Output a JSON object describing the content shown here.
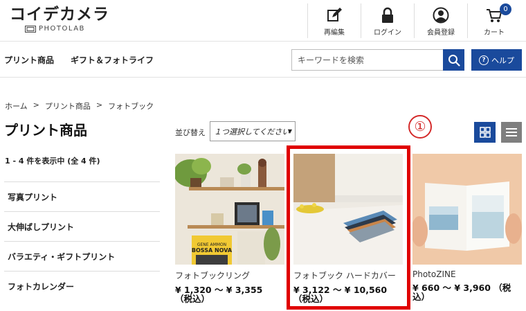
{
  "header": {
    "logo_main": "コイデカメラ",
    "logo_sub": "PHOTOLAB",
    "nav": [
      {
        "label": "再編集",
        "icon": "edit-icon"
      },
      {
        "label": "ログイン",
        "icon": "lock-icon"
      },
      {
        "label": "会員登録",
        "icon": "user-icon"
      },
      {
        "label": "カート",
        "icon": "cart-icon"
      }
    ],
    "cart_count": "0"
  },
  "subnav": {
    "links": [
      "プリント商品",
      "ギフト＆フォトライフ"
    ],
    "search_placeholder": "キーワードを検索",
    "help_label": "ヘルプ"
  },
  "breadcrumb": [
    "ホーム",
    ">",
    "プリント商品",
    ">",
    "フォトブック"
  ],
  "page_title": "プリント商品",
  "result_count": "1 - 4 件を表示中 (全 4 件)",
  "sidebar": {
    "items": [
      "写真プリント",
      "大伸ばしプリント",
      "バラエティ・ギフトプリント",
      "フォトカレンダー"
    ]
  },
  "sort": {
    "label": "並び替え",
    "selected": "１つ選択してください"
  },
  "annotation": "①",
  "products": [
    {
      "name": "フォトブックリング",
      "price": "¥ 1,320 ～ ¥ 3,355",
      "tax": "（税込）"
    },
    {
      "name": "フォトブック ハードカバー",
      "price": "¥ 3,122 ～ ¥ 10,560",
      "tax": "（税込）"
    },
    {
      "name": "PhotoZINE",
      "price": "¥ 660 ～ ¥ 3,960 （税",
      "tax": "込）"
    }
  ],
  "colors": {
    "brand_blue": "#1a4a9c",
    "highlight_red": "#e00000",
    "list_view_gray": "#7f7f7f"
  }
}
